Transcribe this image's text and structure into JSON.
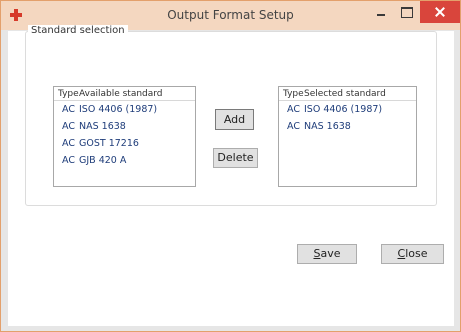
{
  "window": {
    "title": "Output Format Setup",
    "accent_color": "#e3a06c",
    "close_color": "#d9453c",
    "app_icon": "red-plus-icon"
  },
  "group": {
    "title": "Standard selection"
  },
  "available": {
    "header_type": "Type",
    "header_standard": "Available standard",
    "rows": [
      {
        "type": "AC",
        "standard": "ISO 4406 (1987)"
      },
      {
        "type": "AC",
        "standard": "NAS 1638"
      },
      {
        "type": "AC",
        "standard": "GOST 17216"
      },
      {
        "type": "AC",
        "standard": "GJB 420 A"
      }
    ]
  },
  "selected": {
    "header_type": "Type",
    "header_standard": "Selected standard",
    "rows": [
      {
        "type": "AC",
        "standard": "ISO 4406 (1987)"
      },
      {
        "type": "AC",
        "standard": "NAS 1638"
      }
    ]
  },
  "buttons": {
    "add": "Add",
    "delete": "Delete",
    "save_mnemonic": "S",
    "save_rest": "ave",
    "close_mnemonic": "C",
    "close_rest": "lose"
  }
}
